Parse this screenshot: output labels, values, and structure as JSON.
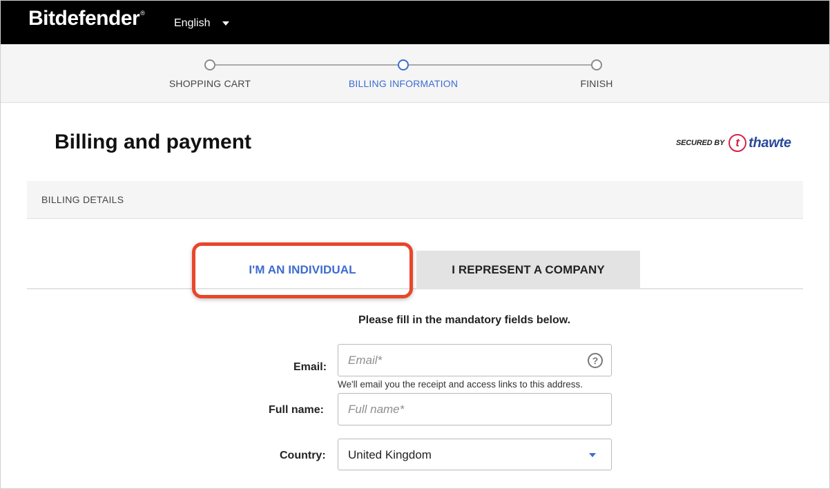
{
  "header": {
    "logo_text": "Bitdefender",
    "logo_mark": "®",
    "language": "English"
  },
  "stepper": {
    "steps": [
      {
        "label": "SHOPPING CART",
        "active": false
      },
      {
        "label": "BILLING INFORMATION",
        "active": true
      },
      {
        "label": "FINISH",
        "active": false
      }
    ]
  },
  "page": {
    "title": "Billing and payment",
    "secured_by": "SECURED BY",
    "secured_brand_mark": "t",
    "secured_brand": "thawte"
  },
  "section": {
    "title": "BILLING DETAILS"
  },
  "tabs": {
    "individual": "I'M AN INDIVIDUAL",
    "company": "I REPRESENT A COMPANY",
    "selected": "individual"
  },
  "form": {
    "instruction": "Please fill in the mandatory fields below.",
    "email": {
      "label": "Email:",
      "placeholder": "Email*",
      "value": "",
      "hint": "We'll email you the receipt and access links to this address.",
      "help_icon": "question-circle-icon",
      "help_glyph": "?"
    },
    "full_name": {
      "label": "Full name:",
      "placeholder": "Full name*",
      "value": ""
    },
    "country": {
      "label": "Country:",
      "selected": "United Kingdom"
    }
  },
  "colors": {
    "accent": "#3c6ccf",
    "highlight": "#e8462b",
    "header_bg": "#000000",
    "thawte_red": "#d4214a",
    "thawte_blue": "#2a4a98"
  }
}
